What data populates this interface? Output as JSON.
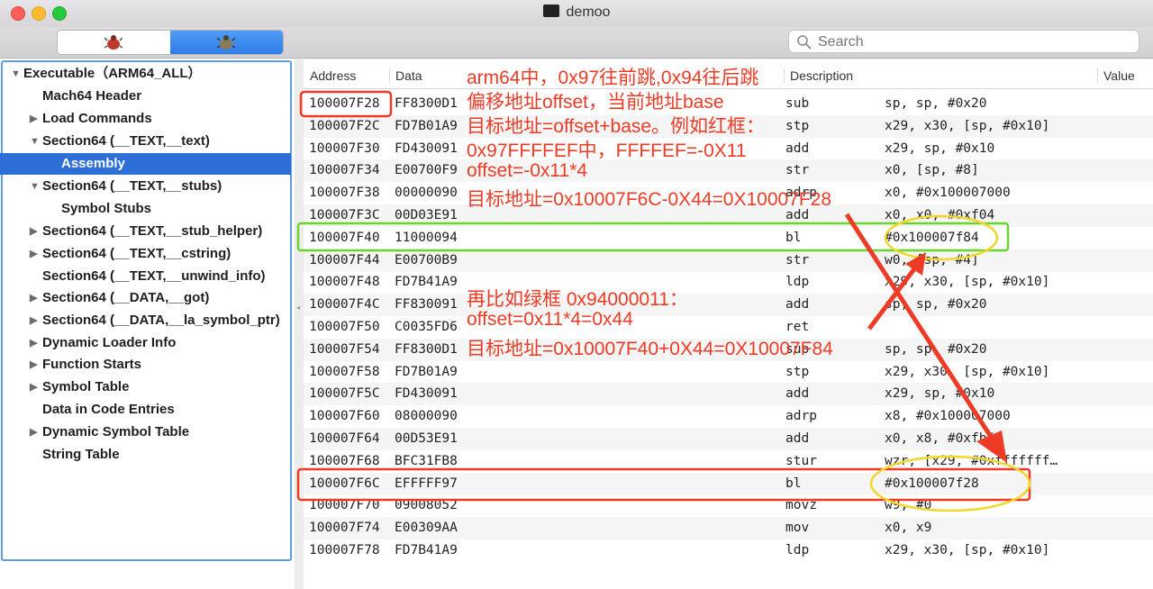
{
  "window": {
    "title": "demoo"
  },
  "toolbar": {
    "search_placeholder": "Search"
  },
  "sidebar": {
    "items": [
      {
        "label": "Executable（ARM64_ALL）",
        "arrow": "▼"
      },
      {
        "label": "Mach64 Header",
        "arrow": ""
      },
      {
        "label": "Load Commands",
        "arrow": "▶"
      },
      {
        "label": "Section64 (__TEXT,__text)",
        "arrow": "▼"
      },
      {
        "label": "Assembly",
        "arrow": ""
      },
      {
        "label": "Section64 (__TEXT,__stubs)",
        "arrow": "▼"
      },
      {
        "label": "Symbol Stubs",
        "arrow": ""
      },
      {
        "label": "Section64 (__TEXT,__stub_helper)",
        "arrow": "▶"
      },
      {
        "label": "Section64 (__TEXT,__cstring)",
        "arrow": "▶"
      },
      {
        "label": "Section64 (__TEXT,__unwind_info)",
        "arrow": ""
      },
      {
        "label": "Section64 (__DATA,__got)",
        "arrow": "▶"
      },
      {
        "label": "Section64 (__DATA,__la_symbol_ptr)",
        "arrow": "▶"
      },
      {
        "label": "Dynamic Loader Info",
        "arrow": "▶"
      },
      {
        "label": "Function Starts",
        "arrow": "▶"
      },
      {
        "label": "Symbol Table",
        "arrow": "▶"
      },
      {
        "label": "Data in Code Entries",
        "arrow": ""
      },
      {
        "label": "Dynamic Symbol Table",
        "arrow": "▶"
      },
      {
        "label": "String Table",
        "arrow": ""
      }
    ]
  },
  "table": {
    "headers": [
      "Address",
      "Data",
      "Description",
      "Value"
    ],
    "rows": [
      [
        "100007F28",
        "FF8300D1",
        "sub",
        "sp, sp, #0x20"
      ],
      [
        "100007F2C",
        "FD7B01A9",
        "stp",
        "x29, x30, [sp, #0x10]"
      ],
      [
        "100007F30",
        "FD430091",
        "add",
        "x29, sp, #0x10"
      ],
      [
        "100007F34",
        "E00700F9",
        "str",
        "x0, [sp, #8]"
      ],
      [
        "100007F38",
        "00000090",
        "adrp",
        "x0, #0x100007000"
      ],
      [
        "100007F3C",
        "00D03E91",
        "add",
        "x0, x0, #0xf04"
      ],
      [
        "100007F40",
        "11000094",
        "bl",
        "#0x100007f84"
      ],
      [
        "100007F44",
        "E00700B9",
        "str",
        "w0, [sp, #4]"
      ],
      [
        "100007F48",
        "FD7B41A9",
        "ldp",
        "x29, x30, [sp, #0x10]"
      ],
      [
        "100007F4C",
        "FF830091",
        "add",
        "sp, sp, #0x20"
      ],
      [
        "100007F50",
        "C0035FD6",
        "ret",
        ""
      ],
      [
        "100007F54",
        "FF8300D1",
        "sub",
        "sp, sp, #0x20"
      ],
      [
        "100007F58",
        "FD7B01A9",
        "stp",
        "x29, x30, [sp, #0x10]"
      ],
      [
        "100007F5C",
        "FD430091",
        "add",
        "x29, sp, #0x10"
      ],
      [
        "100007F60",
        "08000090",
        "adrp",
        "x8, #0x100007000"
      ],
      [
        "100007F64",
        "00D53E91",
        "add",
        "x0, x8, #0xfb5"
      ],
      [
        "100007F68",
        "BFC31FB8",
        "stur",
        "wzr, [x29, #0xfffffff…"
      ],
      [
        "100007F6C",
        "EFFFFF97",
        "bl",
        "#0x100007f28"
      ],
      [
        "100007F70",
        "09008052",
        "movz",
        "w9, #0"
      ],
      [
        "100007F74",
        "E00309AA",
        "mov",
        "x0, x9"
      ],
      [
        "100007F78",
        "FD7B41A9",
        "ldp",
        "x29, x30, [sp, #0x10]"
      ]
    ]
  },
  "annotations": {
    "top": [
      "arm64中，0x97往前跳,0x94往后跳",
      "偏移地址offset，当前地址base",
      "目标地址=offset+base。例如红框：",
      "0x97FFFFEF中，FFFFEF=-0X11",
      "offset=-0x11*4",
      "目标地址=0x10007F6C-0X44=0X10007F28"
    ],
    "mid": [
      "再比如绿框 0x94000011：",
      "offset=0x11*4=0x44",
      "目标地址=0x10007F40+0X44=0X10007F84"
    ]
  },
  "colors": {
    "selection": "#2d6fd6",
    "annotation_red": "#ee3b26",
    "green_box": "#6ad629",
    "yellow_circle": "#f2d62a"
  }
}
